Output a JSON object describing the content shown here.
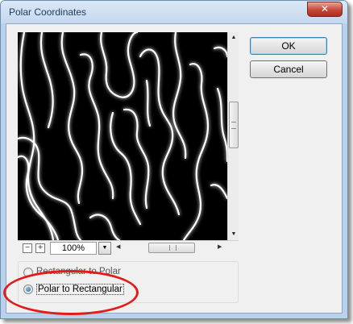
{
  "window": {
    "title": "Polar Coordinates",
    "close_glyph": "✕"
  },
  "buttons": {
    "ok": "OK",
    "cancel": "Cancel"
  },
  "preview": {
    "zoom_out_glyph": "−",
    "zoom_in_glyph": "+",
    "zoom_value": "100%",
    "dropdown_glyph": "▼",
    "scroll_left_glyph": "◀",
    "scroll_right_glyph": "▶",
    "scroll_up_glyph": "▲",
    "scroll_down_glyph": "▼"
  },
  "options": {
    "rect_to_polar": "Rectangular to Polar",
    "polar_to_rect": "Polar to Rectangular",
    "selected": "polar_to_rect"
  },
  "colors": {
    "highlight": "#e21b1b",
    "preview_bg": "#000000"
  }
}
